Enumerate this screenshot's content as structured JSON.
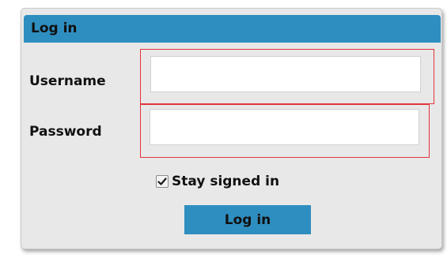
{
  "login_panel": {
    "title": "Log in",
    "username": {
      "label": "Username",
      "value": "",
      "placeholder": ""
    },
    "password": {
      "label": "Password",
      "value": "",
      "placeholder": ""
    },
    "remember": {
      "label": "Stay signed in",
      "checked": true,
      "icon": "checkmark-icon"
    },
    "submit_label": "Log in"
  },
  "colors": {
    "header_bg": "#2f8ec0",
    "button_bg": "#2f8ec0",
    "panel_bg": "#e8e8e8",
    "highlight_border": "#e0343a"
  }
}
